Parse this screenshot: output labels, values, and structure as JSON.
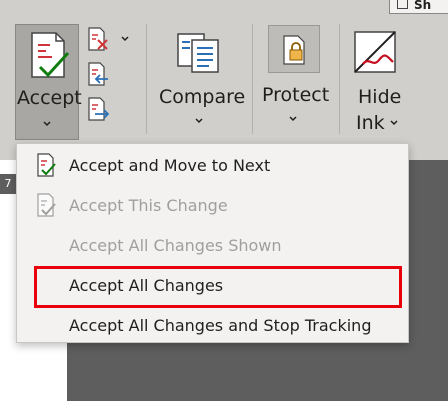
{
  "top_tab": {
    "label": "Sh"
  },
  "ribbon": {
    "accept_label": "Accept",
    "compare_label": "Compare",
    "protect_label": "Protect",
    "hide_ink_line1": "Hide",
    "hide_ink_line2": "Ink",
    "page_number": "7"
  },
  "menu": {
    "items": [
      {
        "label": "Accept and Move to Next",
        "enabled": true
      },
      {
        "label": "Accept This Change",
        "enabled": false
      },
      {
        "label": "Accept All Changes Shown",
        "enabled": false
      },
      {
        "label": "Accept All Changes",
        "enabled": true
      },
      {
        "label": "Accept All Changes and Stop Tracking",
        "enabled": true
      }
    ]
  },
  "colors": {
    "ribbon_bg": "#d1cfcc",
    "menu_bg": "#f3f2f1",
    "highlight_border": "#e8000b",
    "disabled_text": "#a19f9d"
  }
}
